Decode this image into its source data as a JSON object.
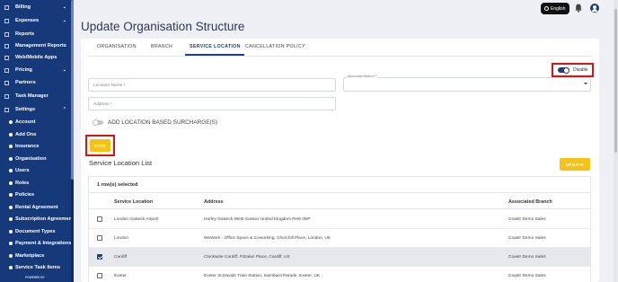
{
  "sidebar": {
    "items": [
      {
        "label": "Billing",
        "icon": "billing-icon",
        "chevron": "⌄"
      },
      {
        "label": "Expenses",
        "icon": "expenses-icon",
        "chevron": "⌄"
      },
      {
        "label": "Reports",
        "icon": "reports-icon"
      },
      {
        "label": "Management Reports",
        "icon": "management-reports-icon"
      },
      {
        "label": "Web/Mobile Apps",
        "icon": "apps-icon"
      },
      {
        "label": "Pricing",
        "icon": "pricing-icon",
        "chevron": "⌄"
      },
      {
        "label": "Partners",
        "icon": "partners-icon"
      },
      {
        "label": "Task Manager",
        "icon": "task-manager-icon"
      },
      {
        "label": "Settings",
        "icon": "settings-icon",
        "chevron": "⌃"
      }
    ],
    "subitems": [
      "Account",
      "Add Ons",
      "Insurance",
      "Organisation",
      "Users",
      "Roles",
      "Policies",
      "Rental Agreement",
      "Subscription Agreement",
      "Document Types",
      "Payment & Integrations",
      "Marketplace",
      "Service Task Items"
    ],
    "powered_by": "POWERED BY"
  },
  "header": {
    "language_label": "English"
  },
  "page": {
    "title": "Update Organisation Structure"
  },
  "tabs": [
    {
      "label": "ORGANISATION",
      "active": false
    },
    {
      "label": "BRANCH",
      "active": false
    },
    {
      "label": "SERVICE LOCATION",
      "active": true
    },
    {
      "label": "CANCELLATION POLICY",
      "active": false
    }
  ],
  "form": {
    "disable_label": "Disable",
    "location_name_placeholder": "Location Name *",
    "associated_branch_label": "Associated Branch *",
    "associated_branch_value": "",
    "address_placeholder": "Address *",
    "surcharge_label": "ADD LOCATION BASED SURCHARGE(S)",
    "save_label": "SAVE"
  },
  "list": {
    "title": "Service Location List",
    "update_label": "UPDATE",
    "selected_text": "1 row(s) selected",
    "columns": [
      "Service Location",
      "Address",
      "Associated Branch"
    ],
    "rows": [
      {
        "location": "London Gatwick Airport",
        "address": "Horley Gatwick West Sussex United Kingdom RH6 0NP",
        "branch": "Coastr Demo Sales",
        "checked": false
      },
      {
        "location": "London",
        "address": "WeWork - Office Space & Coworking, Churchill Place, London, UK",
        "branch": "Coastr Demo Sales",
        "checked": false
      },
      {
        "location": "Cardiff",
        "address": "Clockwise Cardiff, Fitzalan Place, Cardiff, UK",
        "branch": "Coastr Demo Sales",
        "checked": true
      },
      {
        "location": "Exeter",
        "address": "Exeter St.Davids Train Station, Isambard Parade, Exeter, UK",
        "branch": "Coastr Demo Sales",
        "checked": false
      }
    ]
  },
  "colors": {
    "sidebar_bg": "#16397a",
    "accent": "#1f3f7d",
    "button_yellow": "#f6c314",
    "highlight_red": "#e01010"
  }
}
